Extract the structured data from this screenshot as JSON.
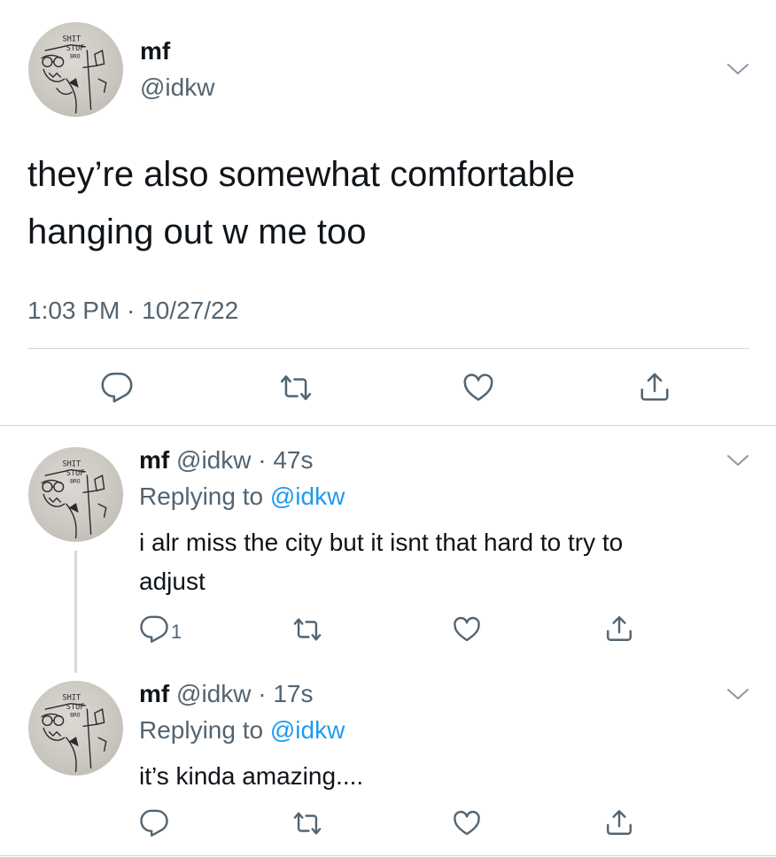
{
  "main_tweet": {
    "name": "mf",
    "handle": "@idkw",
    "text_line1": "they’re also somewhat comfortable",
    "text_line2": "hanging out w me too",
    "timestamp": "1:03 PM · 10/27/22"
  },
  "replies": [
    {
      "name": "mf",
      "meta": "@idkw · 47s",
      "replying_prefix": "Replying to ",
      "replying_to": "@idkw",
      "text_line1": "i alr miss the city but it isnt that hard to try to",
      "text_line2": "adjust",
      "reply_count": "1"
    },
    {
      "name": "mf",
      "meta": "@idkw · 17s",
      "replying_prefix": "Replying to ",
      "replying_to": "@idkw",
      "text_line1": "it’s kinda amazing....",
      "reply_count": ""
    }
  ],
  "avatar_doodle_text": "SHIT STUF BRO",
  "colors": {
    "accent": "#1d9bf0",
    "text": "#0f1419",
    "muted": "#536471",
    "divider": "#cfd9de"
  }
}
